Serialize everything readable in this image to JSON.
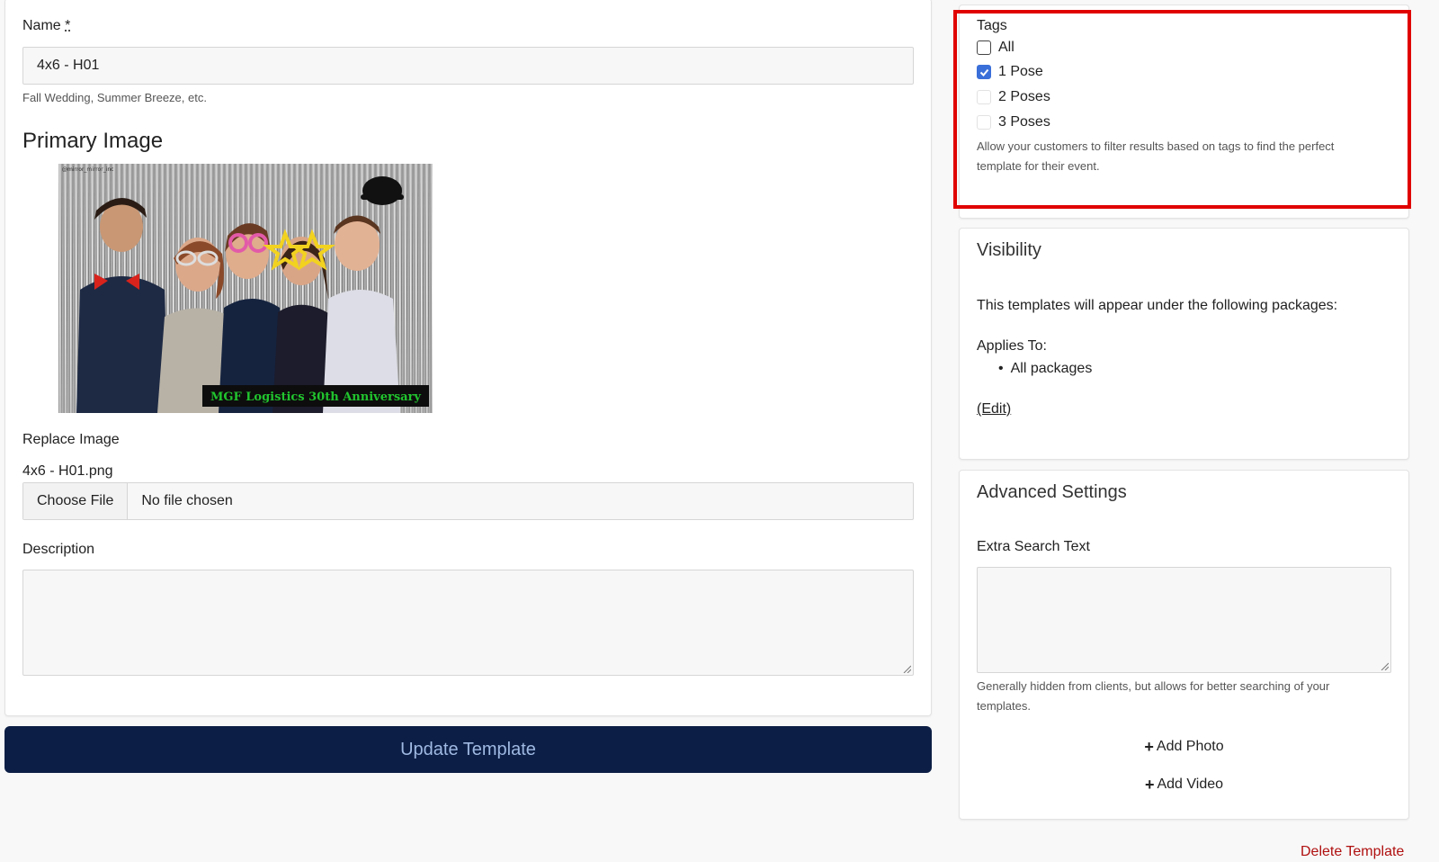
{
  "form": {
    "name_label": "Name",
    "required_marker": "*",
    "name_value": "4x6 - H01",
    "name_help": "Fall Wedding, Summer Breeze, etc.",
    "primary_image_heading": "Primary Image",
    "image_banner_text": "MGF Logistics 30th Anniversary",
    "image_watermark": "@mirror_mirror_inc",
    "replace_image_label": "Replace Image",
    "current_file_name": "4x6 - H01.png",
    "choose_file_label": "Choose File",
    "file_status": "No file chosen",
    "description_label": "Description",
    "description_value": "",
    "submit_label": "Update Template"
  },
  "tags": {
    "heading": "Tags",
    "items": [
      {
        "label": "All",
        "checked": false
      },
      {
        "label": "1 Pose",
        "checked": true
      },
      {
        "label": "2 Poses",
        "checked": false
      },
      {
        "label": "3 Poses",
        "checked": false
      }
    ],
    "help_line1": "Allow your customers to filter results based on tags to find the perfect",
    "help_line2": "template for their event.",
    "highlight_color": "#e00000"
  },
  "visibility": {
    "heading": "Visibility",
    "description": "This templates will appear under the following packages:",
    "applies_to_label": "Applies To:",
    "packages": [
      "All packages"
    ],
    "edit_link": "(Edit)"
  },
  "advanced": {
    "heading": "Advanced Settings",
    "extra_search_label": "Extra Search Text",
    "extra_search_value": "",
    "help_line1": "Generally hidden from clients, but allows for better searching of your",
    "help_line2": "templates.",
    "add_photo_label": "Add Photo",
    "add_video_label": "Add Video"
  },
  "delete_label": "Delete Template",
  "colors": {
    "primary_button": "#0c1e45",
    "primary_button_text": "#9fb9e2",
    "checkbox_checked": "#3a6fd9",
    "delete_text": "#b01010"
  }
}
